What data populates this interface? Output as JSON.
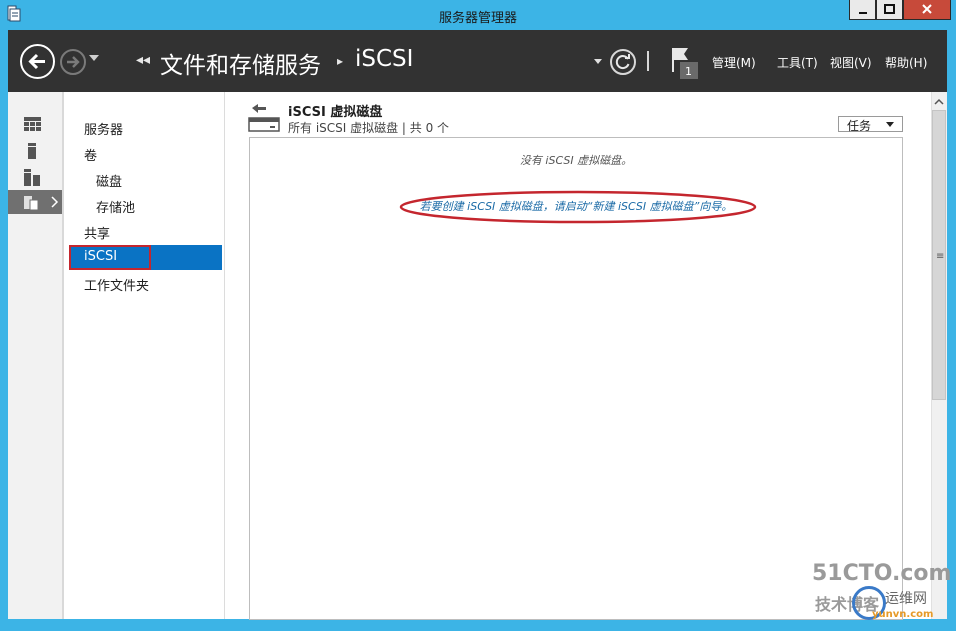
{
  "window": {
    "title": "服务器管理器"
  },
  "header": {
    "breadcrumb_root": "文件和存储服务",
    "breadcrumb_current": "iSCSI",
    "breadcrumb_back_glyph": "◂◂",
    "breadcrumb_sep_glyph": "▸",
    "notification_count": "1",
    "menus": {
      "manage": "管理(M)",
      "tools": "工具(T)",
      "view": "视图(V)",
      "help": "帮助(H)"
    }
  },
  "nav": {
    "items": [
      {
        "label": "服务器"
      },
      {
        "label": "卷"
      },
      {
        "label": "磁盘"
      },
      {
        "label": "存储池"
      },
      {
        "label": "共享"
      },
      {
        "label": "iSCSI",
        "selected": true
      },
      {
        "label": "工作文件夹"
      }
    ]
  },
  "tile": {
    "title": "iSCSI 虚拟磁盘",
    "subtitle": "所有 iSCSI 虚拟磁盘 | 共 0 个",
    "tasks_label": "任务",
    "empty_message": "没有 iSCSI 虚拟磁盘。",
    "wizard_link": "若要创建 iSCSI 虚拟磁盘，请启动“新建 iSCSI 虚拟磁盘”向导。"
  },
  "watermark": {
    "main": "51CTO.com",
    "sub": "技术博客",
    "sub2": "运维网",
    "url": "yunvn.com"
  },
  "icons": {
    "back": "back-arrow-icon",
    "forward": "forward-arrow-icon",
    "refresh": "refresh-icon",
    "flag": "notification-flag-icon",
    "dashboard": "dashboard-icon",
    "local_server": "local-server-icon",
    "all_servers": "all-servers-icon",
    "file_storage": "file-storage-icon"
  },
  "colors": {
    "accent": "#3cb4e6",
    "header": "#323232",
    "selection": "#0a73c4",
    "highlight_box": "#c4262e",
    "link": "#1a6aa6"
  }
}
